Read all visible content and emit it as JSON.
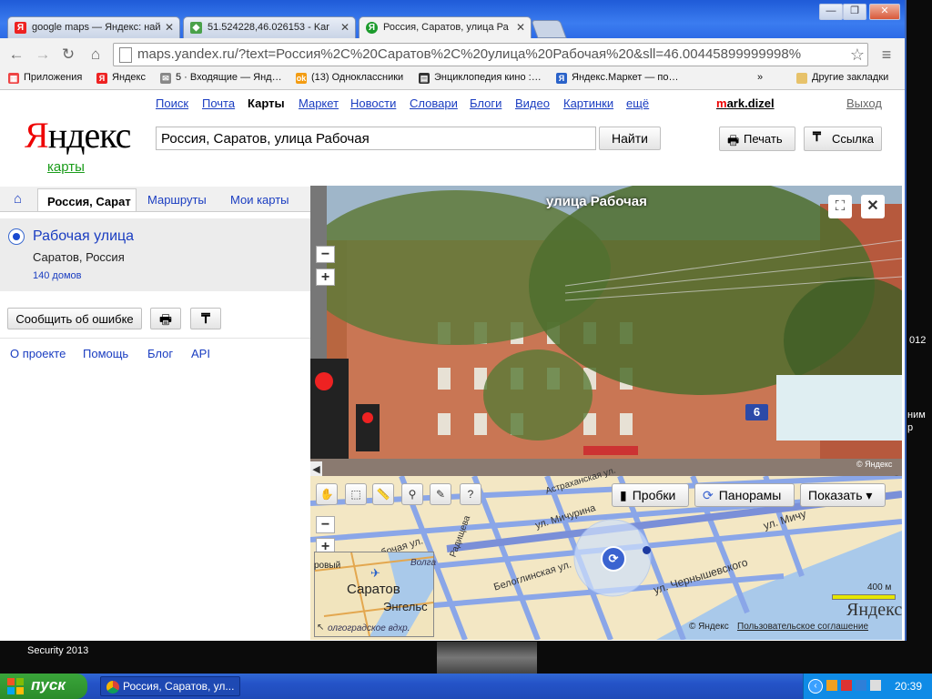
{
  "browser": {
    "tabs": [
      {
        "title": "google maps — Яндекс: най",
        "icon": "yandex-icon"
      },
      {
        "title": "51.524228,46.026153 - Kar",
        "icon": "google-maps-icon"
      },
      {
        "title": "Россия, Саратов, улица Ра",
        "icon": "yandex-maps-icon",
        "active": true
      }
    ],
    "url": "maps.yandex.ru/?text=Россия%2C%20Саратов%2C%20улица%20Рабочая%20&sll=46.00445899999998%",
    "window_buttons": {
      "minimize": "—",
      "maximize": "❐",
      "close": "✕"
    },
    "bookmarks": [
      {
        "label": "Приложения",
        "icon": "apps-icon",
        "color": "#e44"
      },
      {
        "label": "Яндекс",
        "icon": "yandex-icon",
        "color": "#e22"
      },
      {
        "label": "5 · Входящие — Янд…",
        "icon": "mail-icon",
        "color": "#888"
      },
      {
        "label": "(13) Одноклассники",
        "icon": "ok-icon",
        "color": "#f39c12"
      },
      {
        "label": "Энциклопедия кино :…",
        "icon": "film-icon",
        "color": "#333"
      },
      {
        "label": "Яндекс.Маркет — по…",
        "icon": "market-icon",
        "color": "#2a62c9"
      }
    ],
    "bookmarks_more": "»",
    "other_bookmarks": "Другие закладки"
  },
  "header": {
    "logo_red": "Я",
    "logo_rest": "ндекс",
    "service": "карты",
    "nav": [
      {
        "label": "Поиск"
      },
      {
        "label": "Почта"
      },
      {
        "label": "Карты",
        "current": true
      },
      {
        "label": "Маркет"
      },
      {
        "label": "Новости"
      },
      {
        "label": "Словари"
      },
      {
        "label": "Блоги"
      },
      {
        "label": "Видео"
      },
      {
        "label": "Картинки"
      },
      {
        "label": "ещё"
      }
    ],
    "user_first": "m",
    "user_rest": "ark.dizel",
    "logout": "Выход",
    "search_value": "Россия, Саратов, улица Рабочая",
    "search_button": "Найти",
    "print_button": "Печать",
    "link_button": "Ссылка"
  },
  "left_panel": {
    "tabs": {
      "home_icon": "home-icon",
      "current": "Россия, Сарат",
      "routes": "Маршруты",
      "my_maps": "Мои карты"
    },
    "result": {
      "title": "Рабочая улица",
      "subtitle": "Саратов, Россия",
      "count": "140 домов"
    },
    "report_button": "Сообщить об ошибке",
    "footer": [
      "О проекте",
      "Помощь",
      "Блог",
      "API"
    ]
  },
  "panorama": {
    "title": "улица Рабочая",
    "house_number": "6",
    "watermark": "© Яндекс"
  },
  "map": {
    "buttons": {
      "traffic": "Пробки",
      "panoramas": "Панорамы",
      "show": "Показать ▾"
    },
    "streets": [
      "ул. Мичурина",
      "Рабочая ул.",
      "Белоглинская ул.",
      "ул. Чернышевского",
      "Астраханская ул.",
      "ул. Мичу",
      "Радищева"
    ],
    "minimap": {
      "city": "Саратов",
      "town": "Энгельс",
      "river": "Волга",
      "reservoir": "олгоградское вдхр."
    },
    "scale": "400 м",
    "logo": "Яндекс",
    "copyright": "© Яндекс",
    "agreement": "Пользовательское соглашение"
  },
  "desktop": {
    "security": "Security 2013",
    "side_texts": [
      "012",
      "ним",
      "р"
    ]
  },
  "taskbar": {
    "start": "пуск",
    "task": "Россия, Саратов, ул...",
    "clock": "20:39"
  },
  "colors": {
    "link": "#1a3dc1",
    "yandex_red": "#e00",
    "karty_green": "#1a9c1a",
    "xp_blue": "#2453c7"
  }
}
